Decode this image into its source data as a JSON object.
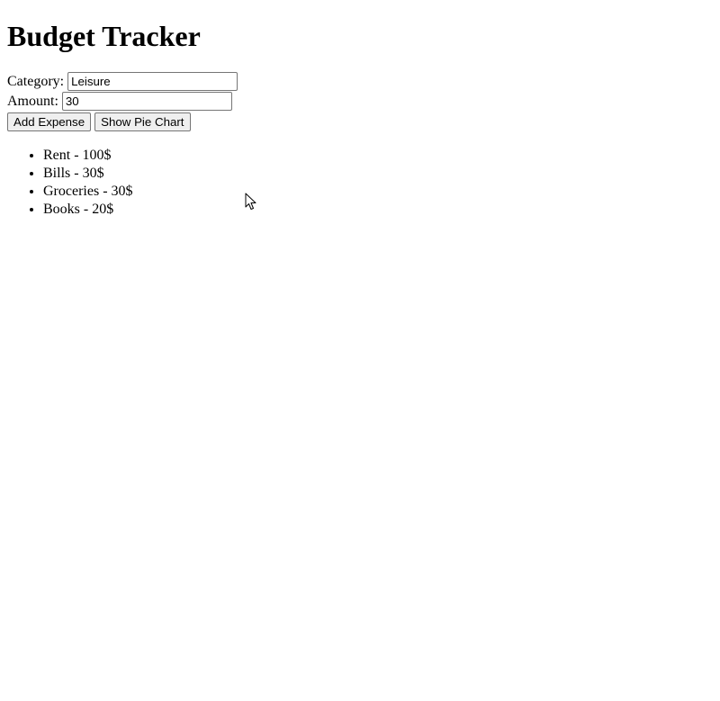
{
  "app": {
    "title": "Budget Tracker"
  },
  "form": {
    "category_label": "Category:",
    "category_value": "Leisure",
    "amount_label": "Amount:",
    "amount_value": "30"
  },
  "buttons": {
    "add_expense": "Add Expense",
    "show_pie_chart": "Show Pie Chart"
  },
  "expenses": [
    {
      "text": "Rent - 100$"
    },
    {
      "text": "Bills - 30$"
    },
    {
      "text": "Groceries - 30$"
    },
    {
      "text": "Books - 20$"
    }
  ],
  "icons": {
    "cursor": "mouse-pointer-icon"
  }
}
